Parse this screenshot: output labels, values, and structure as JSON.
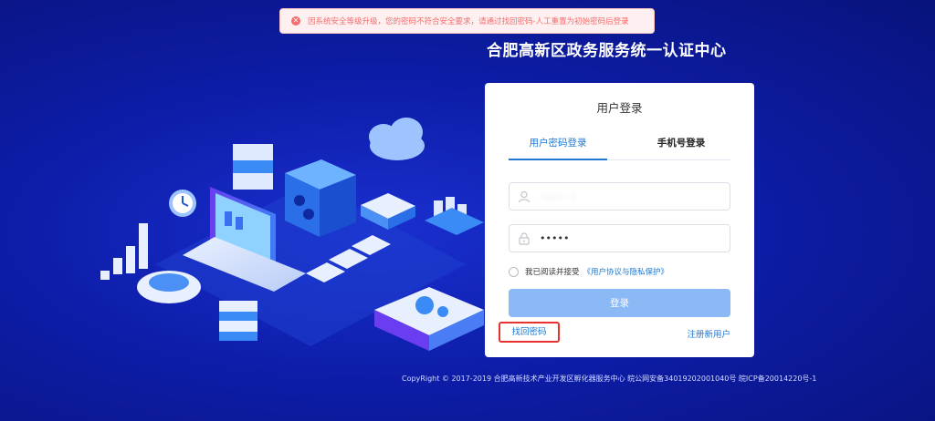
{
  "toast": {
    "icon": "error-circle-icon",
    "message": "因系统安全等级升级，您的密码不符合安全要求，请通过找回密码-人工重置为初始密码后登录"
  },
  "header": {
    "title": "合肥高新区政务服务统一认证中心"
  },
  "login": {
    "title": "用户登录",
    "tabs": [
      {
        "label": "用户密码登录",
        "active": true
      },
      {
        "label": "手机号登录",
        "active": false
      }
    ],
    "username": {
      "value": "·······   -",
      "icon": "user-icon"
    },
    "password": {
      "value": "•••••",
      "icon": "lock-icon"
    },
    "agree": {
      "text": "我已阅读并接受",
      "link": "《用户协议与隐私保护》"
    },
    "submit_label": "登录",
    "forgot_label": "找回密码",
    "register_label": "注册新用户"
  },
  "footer": {
    "text": "CopyRight © 2017-2019 合肥高新技术产业开发区孵化器服务中心 皖公网安备34019202001040号 皖ICP备20014220号-1"
  },
  "colors": {
    "primary": "#1f78d1",
    "button": "#8ab9f5",
    "error": "#f56c6c",
    "highlight": "#e8322f"
  }
}
